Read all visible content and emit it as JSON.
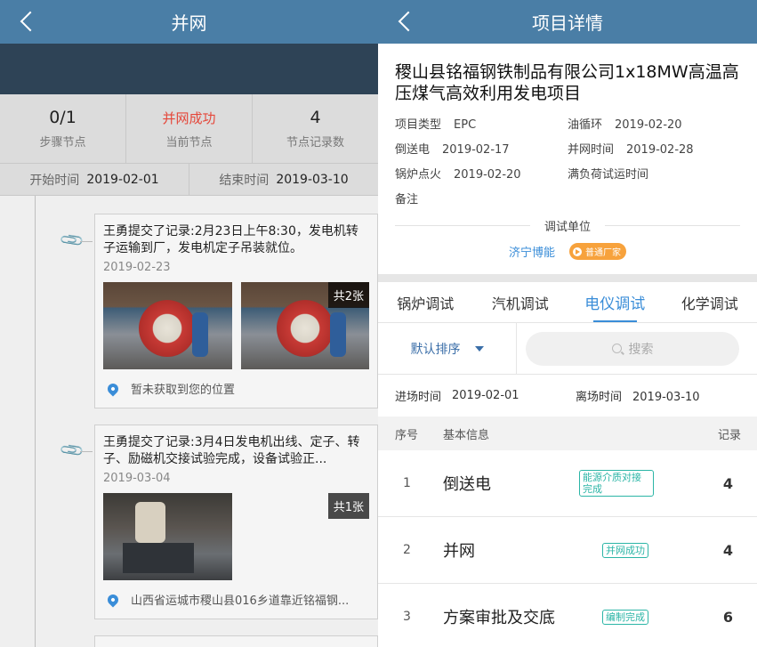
{
  "left": {
    "title": "并网",
    "stats": [
      {
        "value": "0/1",
        "label": "步骤节点"
      },
      {
        "value": "并网成功",
        "label": "当前节点"
      },
      {
        "value": "4",
        "label": "节点记录数"
      }
    ],
    "start_label": "开始时间",
    "start_value": "2019-02-01",
    "end_label": "结束时间",
    "end_value": "2019-03-10",
    "records": [
      {
        "text": "王勇提交了记录:2月23日上午8:30，发电机转子运输到厂，发电机定子吊装就位。",
        "date": "2019-02-23",
        "photo_count": "共2张",
        "location": "暂未获取到您的位置"
      },
      {
        "text": "王勇提交了记录:3月4日发电机出线、定子、转子、励磁机交接试验完成，设备试验正...",
        "date": "2019-03-04",
        "photo_count": "共1张",
        "location": "山西省运城市稷山县016乡道靠近铭福钢..."
      }
    ]
  },
  "right": {
    "title": "项目详情",
    "project_name": "稷山县铭福钢铁制品有限公司1x18MW高温高压煤气高效利用发电项目",
    "info": [
      {
        "k": "项目类型",
        "v": "EPC"
      },
      {
        "k": "油循环",
        "v": "2019-02-20"
      },
      {
        "k": "倒送电",
        "v": "2019-02-17"
      },
      {
        "k": "并网时间",
        "v": "2019-02-28"
      },
      {
        "k": "锅炉点火",
        "v": "2019-02-20"
      },
      {
        "k": "满负荷试运时间",
        "v": ""
      },
      {
        "k": "备注",
        "v": ""
      }
    ],
    "debug_unit_label": "调试单位",
    "debug_unit": "济宁博能",
    "vendor_badge": "普通厂家",
    "tabs": [
      "锅炉调试",
      "汽机调试",
      "电仪调试",
      "化学调试"
    ],
    "sort_label": "默认排序",
    "search_placeholder": "搜索",
    "entry_label": "进场时间",
    "entry_value": "2019-02-01",
    "exit_label": "离场时间",
    "exit_value": "2019-03-10",
    "columns": [
      "序号",
      "基本信息",
      "记录"
    ],
    "rows": [
      {
        "no": "1",
        "name": "倒送电",
        "tag": "能源介质对接完成",
        "count": "4"
      },
      {
        "no": "2",
        "name": "并网",
        "tag": "并网成功",
        "count": "4"
      },
      {
        "no": "3",
        "name": "方案审批及交底",
        "tag": "编制完成",
        "count": "6"
      }
    ]
  },
  "colors": {
    "header": "#4a7ea6",
    "accent": "#3a8dd8",
    "tag": "#2bb5a6",
    "status_red": "#e5473a"
  }
}
